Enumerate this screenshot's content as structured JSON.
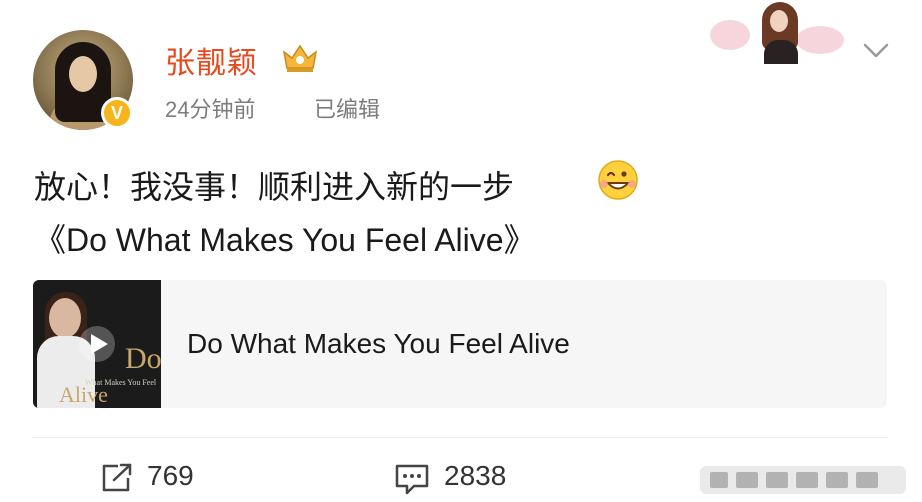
{
  "user": {
    "name": "张靓颖",
    "time": "24分钟前",
    "edited": "已编辑"
  },
  "post": {
    "line1": "放心！我没事！顺利进入新的一步",
    "line2": "《Do What Makes You Feel Alive》"
  },
  "music_card": {
    "title": "Do What Makes You Feel Alive",
    "cover_big": "Do",
    "cover_small": "What Makes You Feel",
    "cover_alive": "Alive"
  },
  "actions": {
    "reposts": "769",
    "comments": "2838"
  },
  "icons": {
    "verified": "verified-badge-icon",
    "crown": "crown-icon",
    "menu": "chevron-down-icon",
    "emoji": "grin-emoji-icon",
    "play": "play-icon",
    "repost": "repost-icon",
    "comment": "comment-icon"
  },
  "colors": {
    "username": "#e8491d",
    "verified": "#f6b51b",
    "card_bg": "#f6f6f7"
  }
}
